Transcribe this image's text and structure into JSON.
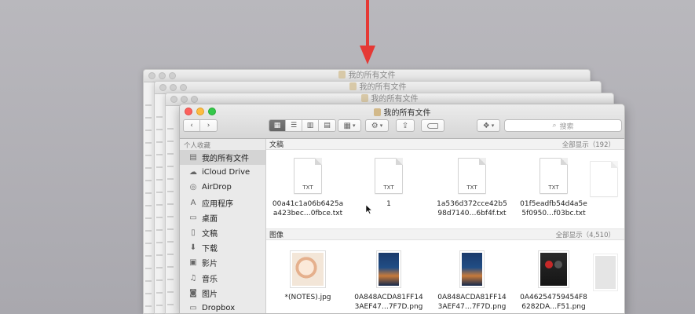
{
  "window": {
    "title": "我的所有文件",
    "background_titles": [
      "我的所有文件",
      "我的所有文件",
      "我的所有文件"
    ]
  },
  "toolbar": {
    "search_placeholder": "搜索",
    "icons": [
      "back-arrow",
      "forward-arrow",
      "icon-view",
      "list-view",
      "column-view",
      "cover-flow-view",
      "arrange-menu",
      "action-gear-menu",
      "share",
      "tag",
      "dropbox"
    ]
  },
  "sidebar": {
    "section": "个人收藏",
    "items": [
      {
        "label": "我的所有文件",
        "icon": "all-files",
        "selected": true
      },
      {
        "label": "iCloud Drive",
        "icon": "cloud"
      },
      {
        "label": "AirDrop",
        "icon": "airdrop"
      },
      {
        "label": "应用程序",
        "icon": "apps"
      },
      {
        "label": "桌面",
        "icon": "desktop"
      },
      {
        "label": "文稿",
        "icon": "documents"
      },
      {
        "label": "下载",
        "icon": "download"
      },
      {
        "label": "影片",
        "icon": "movies"
      },
      {
        "label": "音乐",
        "icon": "music"
      },
      {
        "label": "图片",
        "icon": "pictures"
      },
      {
        "label": "Dropbox",
        "icon": "dropbox"
      }
    ]
  },
  "groups": {
    "docs": {
      "title": "文稿",
      "count": "全部显示（192）",
      "files": [
        {
          "icon_label": "TXT",
          "line1": "00a41c1a06b6425a",
          "line2": "a423bec…0fbce.txt"
        },
        {
          "icon_label": "TXT",
          "line1": "1",
          "line2": ""
        },
        {
          "icon_label": "TXT",
          "line1": "1a536d372cce42b5",
          "line2": "98d7140…6bf4f.txt"
        },
        {
          "icon_label": "TXT",
          "line1": "01f5eadfb54d4a5e",
          "line2": "5f0950…f03bc.txt"
        }
      ]
    },
    "images": {
      "title": "图像",
      "count": "全部显示（4,510）",
      "files": [
        {
          "line1": "*(NOTES).jpg",
          "line2": ""
        },
        {
          "line1": "0A848ACDA81FF14",
          "line2": "3AEF47…7F7D.png"
        },
        {
          "line1": "0A848ACDA81FF14",
          "line2": "3AEF47…7F7D.png"
        },
        {
          "line1": "0A46254759454F8",
          "line2": "6282DA…F51.png"
        }
      ]
    }
  },
  "colors": {
    "arrow": "#e53935",
    "close": "#fc605c",
    "minimize": "#fdbc40",
    "zoom": "#34c84a"
  }
}
